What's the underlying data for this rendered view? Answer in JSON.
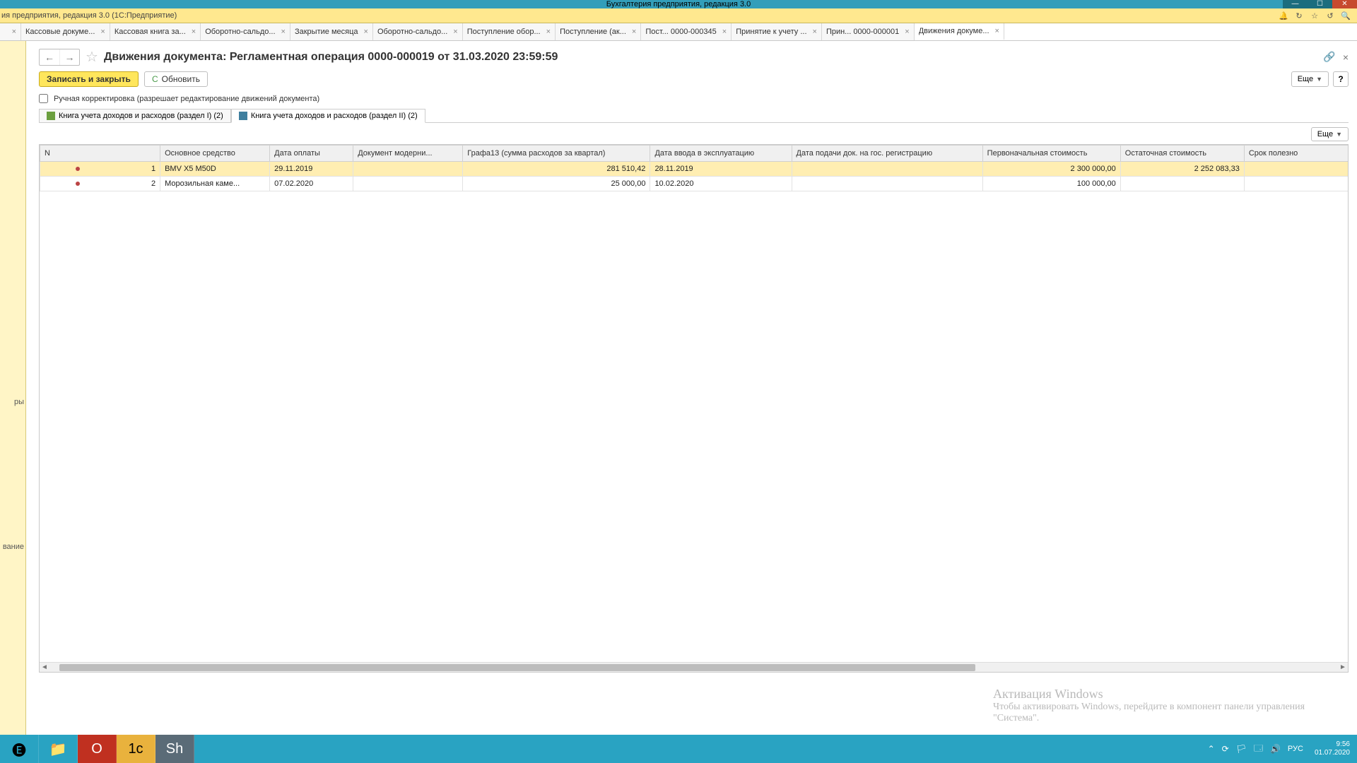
{
  "win": {
    "title_center": "Бухгалтерия предприятия, редакция 3.0"
  },
  "app_title": "ия предприятия, редакция 3.0  (1С:Предприятие)",
  "tabs": [
    {
      "label": "",
      "close": true
    },
    {
      "label": "Кассовые докуме...",
      "close": true
    },
    {
      "label": "Кассовая книга за...",
      "close": true
    },
    {
      "label": "Оборотно-сальдо...",
      "close": true
    },
    {
      "label": "Закрытие месяца",
      "close": true
    },
    {
      "label": "Оборотно-сальдо...",
      "close": true
    },
    {
      "label": "Поступление обор...",
      "close": true
    },
    {
      "label": "Поступление (ак...",
      "close": true
    },
    {
      "label": "Пост...   0000-000345",
      "close": true
    },
    {
      "label": "Принятие к учету ...",
      "close": true
    },
    {
      "label": "Прин...   0000-000001",
      "close": true
    },
    {
      "label": "Движения докуме...",
      "close": true,
      "active": true
    }
  ],
  "sidebar": {
    "t1": "ры",
    "t2": "вание"
  },
  "page_title": "Движения документа: Регламентная операция 0000-000019 от 31.03.2020 23:59:59",
  "buttons": {
    "save": "Записать и закрыть",
    "refresh": "Обновить",
    "more": "Еще",
    "help": "?"
  },
  "manual_edit": "Ручная корректировка (разрешает редактирование движений документа)",
  "inner_tabs": {
    "t1": "Книга учета доходов и расходов (раздел I) (2)",
    "t2": "Книга учета доходов и расходов (раздел II) (2)"
  },
  "columns": [
    "N",
    "Основное средство",
    "Дата оплаты",
    "Документ модерни...",
    "Графа13 (сумма расходов за квартал)",
    "Дата ввода в эксплуатацию",
    "Дата подачи док. на гос. регистрацию",
    "Первоначальная стоимость",
    "Остаточная стоимость",
    "Срок полезно"
  ],
  "rows": [
    {
      "n": "1",
      "asset": "BMV X5 M50D",
      "pay": "29.11.2019",
      "doc": "",
      "g13": "281 510,42",
      "start": "28.11.2019",
      "reg": "",
      "init": "2 300 000,00",
      "rem": "2 252 083,33"
    },
    {
      "n": "2",
      "asset": "Морозильная каме...",
      "pay": "07.02.2020",
      "doc": "",
      "g13": "25 000,00",
      "start": "10.02.2020",
      "reg": "",
      "init": "100 000,00",
      "rem": ""
    }
  ],
  "watermark": {
    "title": "Активация Windows",
    "sub": "Чтобы активировать Windows, перейдите в компонент панели управления \"Система\"."
  },
  "clock": {
    "time": "9:56",
    "date": "01.07.2020",
    "lang": "РУС"
  }
}
